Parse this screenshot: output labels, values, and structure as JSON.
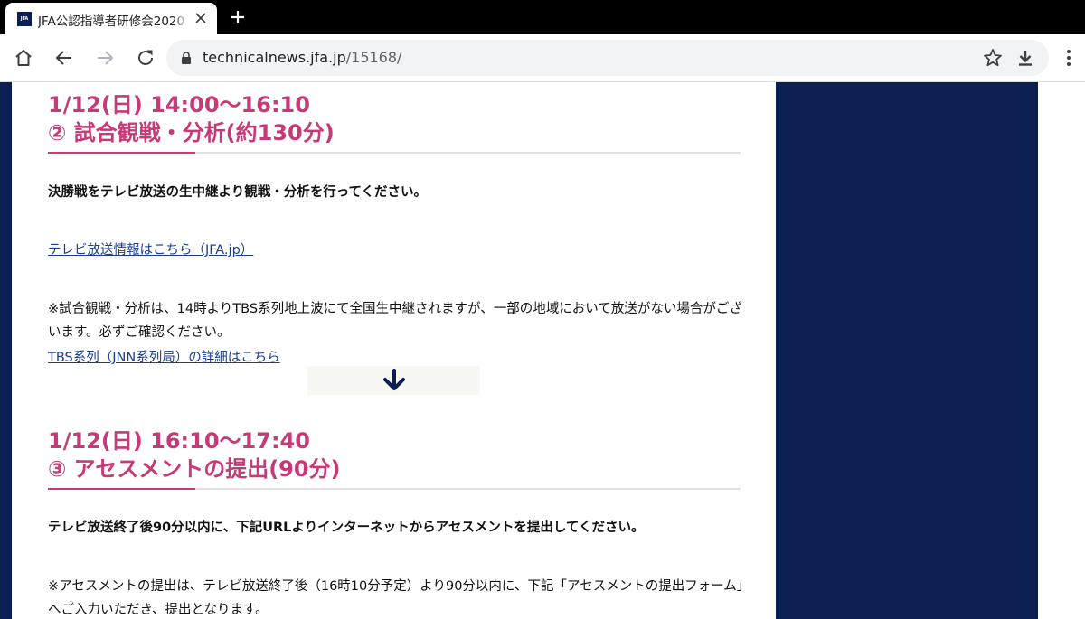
{
  "browser": {
    "tab": {
      "favicon_text": "JFA",
      "title": "JFA公認指導者研修会2020"
    },
    "address": {
      "host": "technicalnews.jfa.jp",
      "path": "/15168/"
    }
  },
  "content": {
    "section2": {
      "time": "1/12(日) 14:00〜16:10",
      "title": "② 試合観戦・分析(約130分)",
      "lead": "決勝戦をテレビ放送の生中継より観戦・分析を行ってください。",
      "link1": "テレビ放送情報はこちら（JFA.jp）",
      "note": "※試合観戦・分析は、14時よりTBS系列地上波にて全国生中継されますが、一部の地域において放送がない場合がございます。必ずご確認ください。",
      "link2": "TBS系列（JNN系列局）の詳細はこちら"
    },
    "section3": {
      "time": "1/12(日) 16:10〜17:40",
      "title": "③ アセスメントの提出(90分)",
      "lead": "テレビ放送終了後90分以内に、下記URLよりインターネットからアセスメントを提出してください。",
      "note": "※アセスメントの提出は、テレビ放送終了後（16時10分予定）より90分以内に、下記「アセスメントの提出フォーム」へご入力いただき、提出となります。"
    }
  },
  "colors": {
    "accent": "#c73a78",
    "navy": "#0b1f52",
    "link": "#1a3e8c"
  }
}
